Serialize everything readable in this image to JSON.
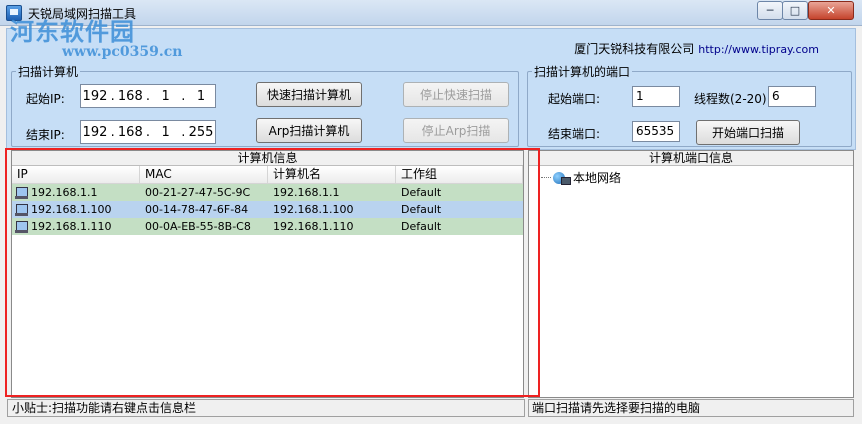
{
  "window": {
    "title": "天锐局域网扫描工具",
    "watermark": "河东软件园",
    "watermark_url": "www.pc0359.cn",
    "minimize": "─",
    "maximize": "□",
    "close": "✕"
  },
  "header": {
    "company": "厦门天锐科技有限公司",
    "url": "http://www.tipray.com"
  },
  "scan_group": {
    "legend": "扫描计算机",
    "start_label": "起始IP:",
    "end_label": "结束IP:",
    "start_ip": [
      "192",
      "168",
      "1",
      "1"
    ],
    "end_ip": [
      "192",
      "168",
      "1",
      "255"
    ],
    "quick_scan": "快速扫描计算机",
    "stop_quick_scan": "停止快速扫描",
    "arp_scan": "Arp扫描计算机",
    "stop_arp_scan": "停止Arp扫描"
  },
  "port_group": {
    "legend": "扫描计算机的端口",
    "start_port_label": "起始端口:",
    "start_port": "1",
    "end_port_label": "结束端口:",
    "end_port": "65535",
    "threads_label": "线程数(2-20):",
    "threads": "6",
    "start_button": "开始端口扫描"
  },
  "computer_info": {
    "title": "计算机信息",
    "columns": [
      "IP",
      "MAC",
      "计算机名",
      "工作组"
    ],
    "rows": [
      [
        "192.168.1.1",
        "00-21-27-47-5C-9C",
        "192.168.1.1",
        "Default"
      ],
      [
        "192.168.1.100",
        "00-14-78-47-6F-84",
        "192.168.1.100",
        "Default"
      ],
      [
        "192.168.1.110",
        "00-0A-EB-55-8B-C8",
        "192.168.1.110",
        "Default"
      ]
    ]
  },
  "port_info": {
    "title": "计算机端口信息",
    "tree_root": "本地网络"
  },
  "status": {
    "left": "小贴士:扫描功能请右键点击信息栏",
    "right": "端口扫描请先选择要扫描的电脑"
  }
}
